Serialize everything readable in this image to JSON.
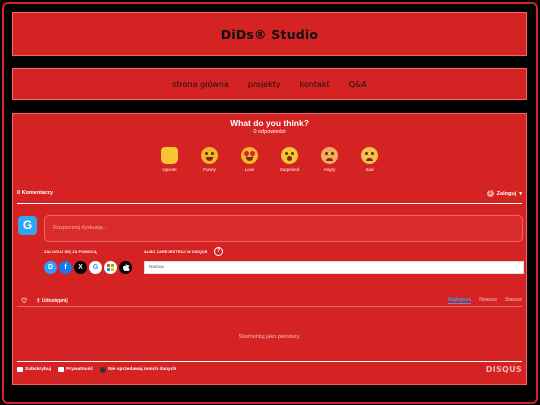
{
  "site": {
    "title": "DiDs® Studio"
  },
  "nav": [
    "strona główna",
    "projekty",
    "kontakt",
    "Q&A"
  ],
  "reactions": {
    "question": "What do you think?",
    "responses": "0 odpowiedzi",
    "items": [
      {
        "icon": "thumbs-up-icon",
        "label": "Upvote"
      },
      {
        "icon": "laughing-face-icon",
        "label": "Funny"
      },
      {
        "icon": "heart-eyes-face-icon",
        "label": "Love"
      },
      {
        "icon": "surprised-face-icon",
        "label": "Surprised"
      },
      {
        "icon": "angry-face-icon",
        "label": "Angry"
      },
      {
        "icon": "sad-face-icon",
        "label": "Sad"
      }
    ]
  },
  "comments": {
    "count_label": "0 Komentarzy",
    "login_label": "Zaloguj",
    "login_badge": "1",
    "avatar_letter": "G",
    "input_placeholder": "Rozpocznij dyskusję...",
    "login_with_label": "ZALOGUJ SIĘ ZA POMOCĄ",
    "or_register_label": "ALBO ZAREJESTRUJ W DISQUS",
    "help_icon": "?",
    "name_placeholder": "Nazwa",
    "share_label": "Udostępnij",
    "sort": [
      "Najlepsze",
      "Nowsze",
      "Starsze"
    ],
    "empty_text": "Skomentuj jako pierwszy."
  },
  "socials": {
    "disqus": "D",
    "facebook": "f",
    "x": "X",
    "google": "G"
  },
  "footer": {
    "subscribe": "Subskrybuj",
    "privacy": "Prywatność",
    "no_sell": "Nie sprzedawaj moich danych",
    "brand": "DISQUS"
  },
  "colors": {
    "panel": "#d52222",
    "accent": "#2ea1ff",
    "background": "#000000"
  }
}
